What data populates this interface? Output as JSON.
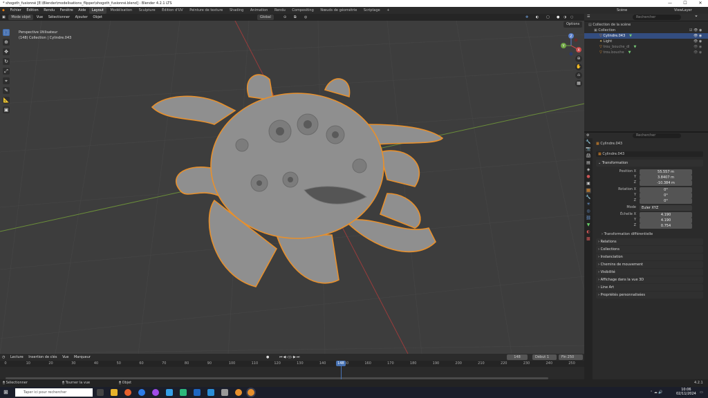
{
  "titlebar": {
    "title": "* shogoth_fusionné [E:\\Blender\\modelisations_flipper\\shogoth_fusionné.blend] - Blender 4.2.1 LTS",
    "minimize": "—",
    "maximize": "☐",
    "close": "✕"
  },
  "topmenu": {
    "items": [
      "Fichier",
      "Édition",
      "Rendu",
      "Fenêtre",
      "Aide"
    ]
  },
  "workspaces": [
    "Layout",
    "Modélisation",
    "Sculpture",
    "Édition d'UV",
    "Peinture de texture",
    "Shading",
    "Animation",
    "Rendu",
    "Compositing",
    "Nœuds de géométrie",
    "Scriptage",
    "+"
  ],
  "scene": {
    "label": "Scène",
    "viewlayer": "ViewLayer"
  },
  "viewport": {
    "mode": "Mode objet",
    "menus": [
      "Vue",
      "Sélectionner",
      "Ajouter",
      "Objet"
    ],
    "orientation": "Global",
    "options": "Options",
    "info_line1": "Perspective Utilisateur",
    "info_line2": "(148) Collection | Cylindre.043",
    "gizmo": {
      "x": "X",
      "y": "Y",
      "z": "Z"
    }
  },
  "tools": [
    "select-box",
    "cursor",
    "move",
    "rotate",
    "scale",
    "transform",
    "annotate",
    "measure",
    "add-cube"
  ],
  "outliner": {
    "search_placeholder": "Rechercher",
    "rows": [
      {
        "label": "Collection de la scène",
        "indent": 0
      },
      {
        "label": "Collection",
        "indent": 1
      },
      {
        "label": "Cylindre.043",
        "indent": 2,
        "selected": true
      },
      {
        "label": "Light",
        "indent": 2
      },
      {
        "label": "trou_bouche_dl",
        "indent": 2
      },
      {
        "label": "trou.bouche",
        "indent": 2
      }
    ]
  },
  "properties": {
    "search_placeholder": "Rechercher",
    "object_name": "Cylindre.043",
    "object_datablock": "Cylindre.043",
    "transform_header": "Transformation",
    "position": {
      "label": "Position X",
      "x": "55.557 m",
      "y": "3.8407 m",
      "z": "-10.384 m",
      "ylabel": "Y",
      "zlabel": "Z"
    },
    "rotation": {
      "label": "Rotation X",
      "x": "0°",
      "y": "0°",
      "z": "0°",
      "ylabel": "Y",
      "zlabel": "Z"
    },
    "mode": {
      "label": "Mode",
      "value": "Euler XYZ"
    },
    "scale": {
      "label": "Échelle X",
      "x": "4.190",
      "y": "4.190",
      "z": "0.754",
      "ylabel": "Y",
      "zlabel": "Z"
    },
    "delta": "Transformation différentielle",
    "sections": [
      "Relations",
      "Collections",
      "Instanciation",
      "Chemins de mouvement",
      "Visibilité",
      "Affichage dans la vue 3D",
      "Line Art",
      "Propriétés personnalisées"
    ]
  },
  "timeline": {
    "menus": [
      "Lecture",
      "Insertion de clés",
      "Vue",
      "Marqueur"
    ],
    "current_frame": "148",
    "start_label": "Début",
    "start": "1",
    "end_label": "Fin",
    "end": "250",
    "ticks": [
      "0",
      "10",
      "20",
      "30",
      "40",
      "50",
      "60",
      "70",
      "80",
      "90",
      "100",
      "110",
      "120",
      "130",
      "140",
      "150",
      "160",
      "170",
      "180",
      "190",
      "200",
      "210",
      "220",
      "230",
      "240",
      "250"
    ],
    "playhead": "148"
  },
  "statusbar": {
    "items": [
      "Sélectionner",
      "Tourner la vue",
      "Objet"
    ],
    "version": "4.2.1"
  },
  "taskbar": {
    "search_placeholder": "Taper ici pour rechercher",
    "time": "10:06",
    "date": "02/11/2024"
  }
}
